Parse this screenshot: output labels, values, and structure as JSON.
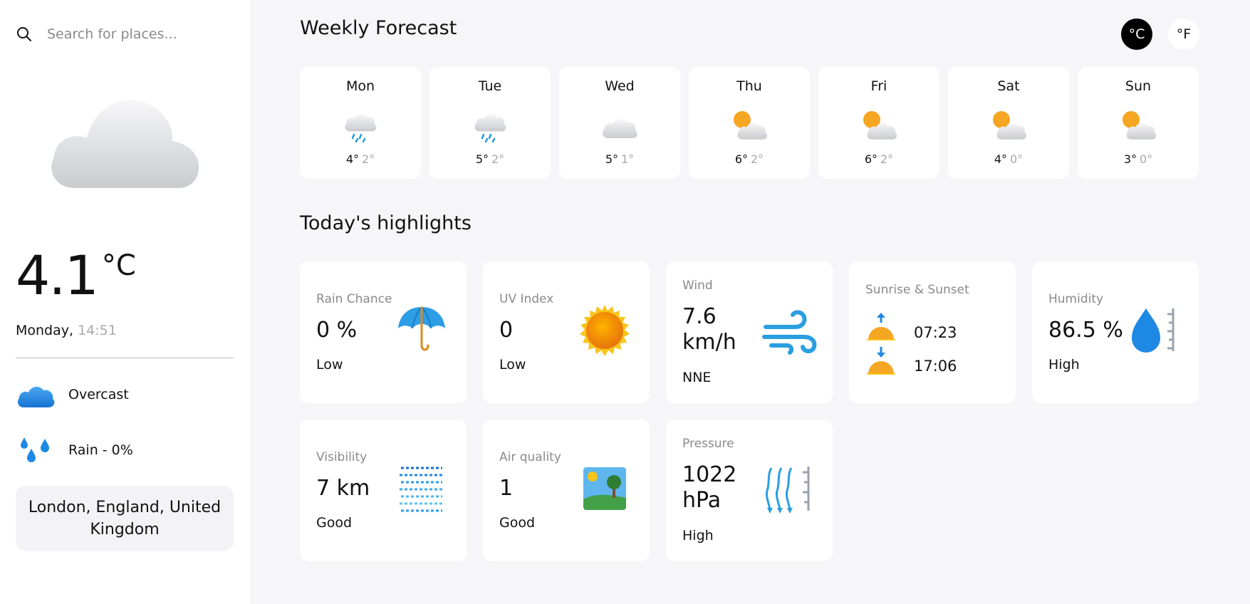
{
  "search": {
    "placeholder": "Search for places..."
  },
  "current": {
    "temperature": "4.1",
    "unit": "°C",
    "day": "Monday,",
    "time": "14:51",
    "condition": "Overcast",
    "rain": "Rain - 0%",
    "location": "London, England, United Kingdom"
  },
  "header": {
    "weekly_title": "Weekly Forecast",
    "highlights_title": "Today's highlights",
    "unit_c": "°C",
    "unit_f": "°F"
  },
  "week": [
    {
      "day": "Mon",
      "hi": "4°",
      "lo": "2°",
      "icon": "rain-cloud-icon"
    },
    {
      "day": "Tue",
      "hi": "5°",
      "lo": "2°",
      "icon": "rain-cloud-icon"
    },
    {
      "day": "Wed",
      "hi": "5°",
      "lo": "1°",
      "icon": "cloud-icon"
    },
    {
      "day": "Thu",
      "hi": "6°",
      "lo": "2°",
      "icon": "partly-cloudy-icon"
    },
    {
      "day": "Fri",
      "hi": "6°",
      "lo": "2°",
      "icon": "partly-cloudy-icon"
    },
    {
      "day": "Sat",
      "hi": "4°",
      "lo": "0°",
      "icon": "partly-cloudy-icon"
    },
    {
      "day": "Sun",
      "hi": "3°",
      "lo": "0°",
      "icon": "partly-cloudy-icon"
    }
  ],
  "highlights": {
    "rain": {
      "title": "Rain Chance",
      "value": "0 %",
      "sub": "Low"
    },
    "uv": {
      "title": "UV Index",
      "value": "0",
      "sub": "Low"
    },
    "wind": {
      "title": "Wind",
      "value": "7.6",
      "unit": "km/h",
      "sub": "NNE"
    },
    "sun": {
      "title": "Sunrise & Sunset",
      "sunrise": "07:23",
      "sunset": "17:06"
    },
    "humidity": {
      "title": "Humidity",
      "value": "86.5 %",
      "sub": "High"
    },
    "visibility": {
      "title": "Visibility",
      "value": "7 km",
      "sub": "Good"
    },
    "air": {
      "title": "Air quality",
      "value": "1",
      "sub": "Good"
    },
    "pressure": {
      "title": "Pressure",
      "value": "1022",
      "unit": "hPa",
      "sub": "High"
    }
  },
  "colors": {
    "accent_blue": "#1e88e5",
    "sun_orange": "#f5a623",
    "selected_unit_bg": "#000000"
  }
}
